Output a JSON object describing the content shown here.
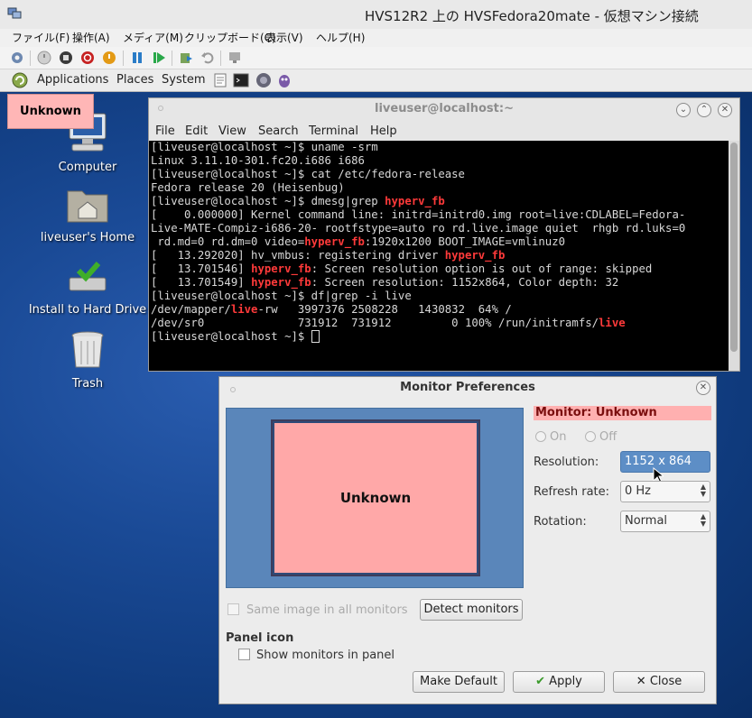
{
  "host": {
    "title": "HVS12R2 上の HVSFedora20mate  - 仮想マシン接続",
    "menu": [
      "ファイル(F)",
      "操作(A)",
      "メディア(M)",
      "クリップボード(C)",
      "表示(V)",
      "ヘルプ(H)"
    ]
  },
  "panel": {
    "menu": [
      "Applications",
      "Places",
      "System"
    ]
  },
  "overlay_tag": "Unknown",
  "desktop_icons": [
    "Computer",
    "liveuser's Home",
    "Install to Hard Drive",
    "Trash"
  ],
  "terminal": {
    "title": "liveuser@localhost:~",
    "menu": [
      "File",
      "Edit",
      "View",
      "Search",
      "Terminal",
      "Help"
    ],
    "lines": [
      "[liveuser@localhost ~]$ uname -srm",
      "Linux 3.11.10-301.fc20.i686 i686",
      "[liveuser@localhost ~]$ cat /etc/fedora-release",
      "Fedora release 20 (Heisenbug)",
      "[liveuser@localhost ~]$ dmesg|grep hyperv_fb",
      "[    0.000000] Kernel command line: initrd=initrd0.img root=live:CDLABEL=Fedora-",
      "Live-MATE-Compiz-i686-20- rootfstype=auto ro rd.live.image quiet  rhgb rd.luks=0",
      " rd.md=0 rd.dm=0 video=hyperv_fb:1920x1200 BOOT_IMAGE=vmlinuz0",
      "[   13.292020] hv_vmbus: registering driver hyperv_fb",
      "[   13.701546] hyperv_fb: Screen resolution option is out of range: skipped",
      "[   13.701549] hyperv_fb: Screen resolution: 1152x864, Color depth: 32",
      "[liveuser@localhost ~]$ df|grep -i live",
      "/dev/mapper/live-rw   3997376 2508228   1430832  64% /",
      "/dev/sr0              731912  731912         0 100% /run/initramfs/live",
      "[liveuser@localhost ~]$ "
    ],
    "highlight_words": [
      "hyperv_fb",
      "live"
    ],
    "highlight_color": "#ff3a3a"
  },
  "dialog": {
    "title": "Monitor Preferences",
    "monitor_box_label": "Unknown",
    "monitor_heading": "Monitor: Unknown",
    "radio_on": "On",
    "radio_off": "Off",
    "resolution_label": "Resolution:",
    "resolution_value": "1152 x 864",
    "refresh_label": "Refresh rate:",
    "refresh_value": "0 Hz",
    "rotation_label": "Rotation:",
    "rotation_value": "Normal",
    "same_image_label": "Same image in all monitors",
    "detect_button": "Detect monitors",
    "panel_icon_heading": "Panel icon",
    "show_monitors_label": "Show monitors in panel",
    "make_default_button": "Make Default",
    "apply_button": "Apply",
    "close_button": "Close"
  },
  "colors": {
    "unknown_pink": "#ffb6b6",
    "selection_blue": "#5d8ec6",
    "monitor_area_blue": "#5a86ba"
  }
}
